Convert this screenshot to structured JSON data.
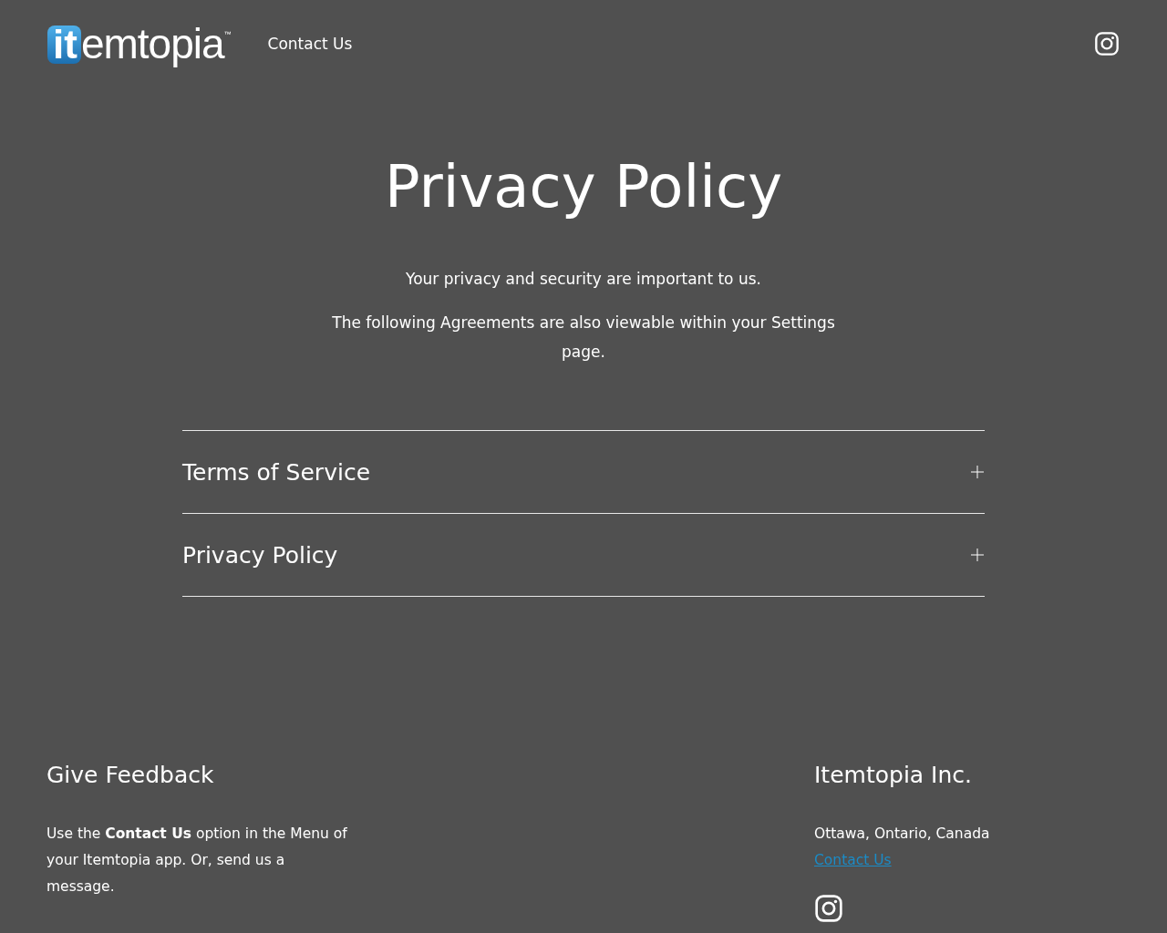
{
  "header": {
    "logo": {
      "badge": "it",
      "text": "emtopia",
      "trademark": "™"
    },
    "nav": [
      {
        "label": "Contact Us"
      }
    ]
  },
  "hero": {
    "title": "Privacy Policy",
    "lines": [
      "Your privacy and security are important to us.",
      "The following Agreements are also viewable within your Settings page."
    ]
  },
  "accordion": [
    {
      "title": "Terms of Service",
      "expanded": false
    },
    {
      "title": "Privacy Policy",
      "expanded": false
    }
  ],
  "footer": {
    "feedback": {
      "title": "Give Feedback",
      "text": "Use the **Contact Us** option in the Menu of your Itemtopia app. Or, send us a message."
    },
    "company": {
      "title": "Itemtopia Inc.",
      "address": "Ottawa, Ontario, Canada",
      "link": "Contact Us"
    }
  }
}
